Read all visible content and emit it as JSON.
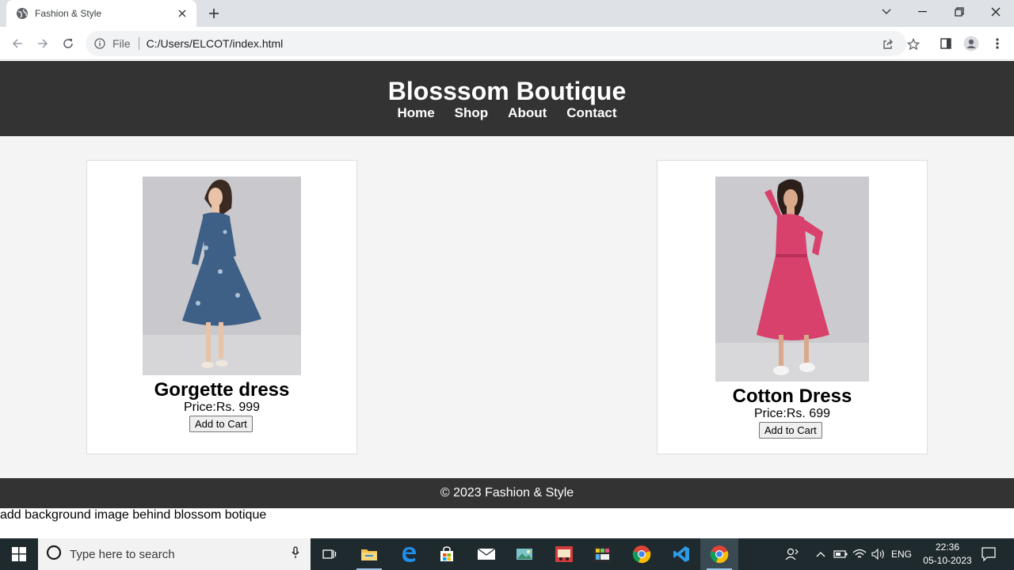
{
  "browser": {
    "tab_title": "Fashion & Style",
    "scheme_label": "File",
    "url": "C:/Users/ELCOT/index.html"
  },
  "site": {
    "title": "Blosssom Boutique",
    "nav": [
      "Home",
      "Shop",
      "About",
      "Contact"
    ],
    "footer": "© 2023 Fashion & Style"
  },
  "products": [
    {
      "name": "Gorgette dress",
      "price": "Price:Rs. 999",
      "button": "Add to Cart",
      "dress_color": "#3e5f86"
    },
    {
      "name": "Cotton Dress",
      "price": "Price:Rs. 699",
      "button": "Add to Cart",
      "dress_color": "#d8416b"
    }
  ],
  "note": "add background image behind blossom botique",
  "taskbar": {
    "search_placeholder": "Type here to search",
    "language": "ENG",
    "time": "22:36",
    "date": "05-10-2023"
  },
  "colors": {
    "header_bg": "#333333",
    "products_bg": "#f4f4f4",
    "taskbar_bg": "#1f2a2f"
  }
}
